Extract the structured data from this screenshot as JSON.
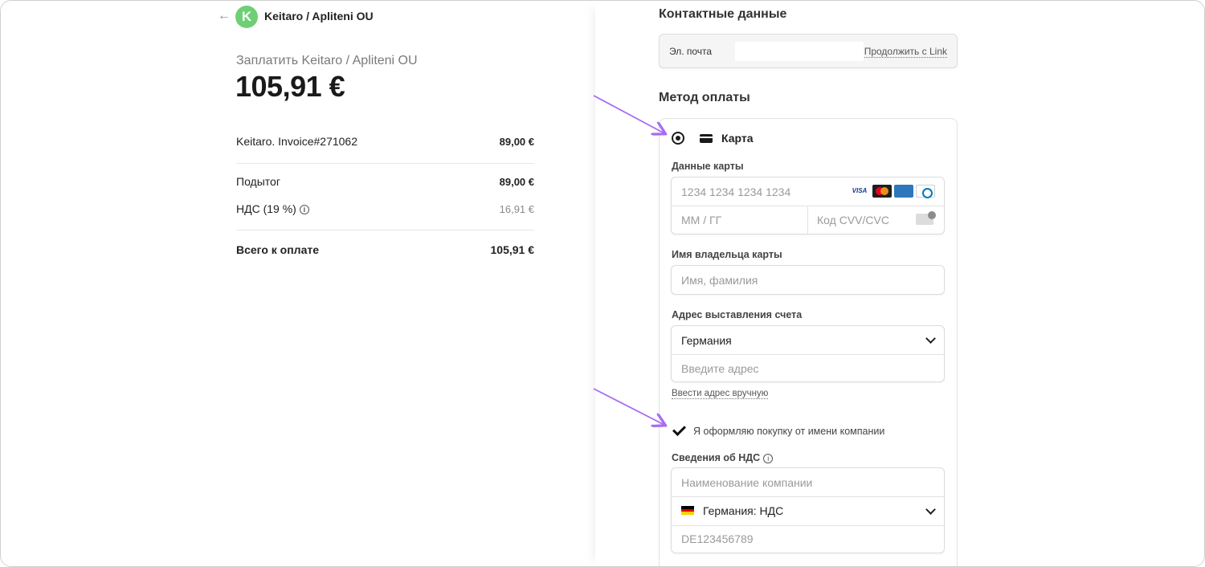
{
  "summary": {
    "merchant": "Keitaro / Apliteni OU",
    "logo_letter": "K",
    "logo_color": "#6fcf74",
    "pay_label": "Заплатить Keitaro / Apliteni OU",
    "pay_amount": "105,91 €",
    "line_item": {
      "label": "Keitaro. Invoice#271062",
      "value": "89,00 €"
    },
    "subtotal": {
      "label": "Подытог",
      "value": "89,00 €"
    },
    "vat": {
      "label": "НДС (19 %)",
      "value": "16,91 €"
    },
    "total": {
      "label": "Всего к оплате",
      "value": "105,91 €"
    }
  },
  "contact": {
    "title": "Контактные данные",
    "email_label": "Эл. почта",
    "email_value": "",
    "link_button": "Продолжить с Link"
  },
  "payment": {
    "title": "Метод оплаты",
    "method_label": "Карта",
    "card_details_label": "Данные карты",
    "card_number_placeholder": "1234 1234 1234 1234",
    "card_brands": [
      "VISA",
      "Mastercard",
      "AMEX",
      "Diners"
    ],
    "expiry_placeholder": "ММ / ГГ",
    "cvc_placeholder": "Код CVV/CVC",
    "cardholder_label": "Имя владельца карты",
    "cardholder_placeholder": "Имя, фамилия",
    "billing_label": "Адрес выставления счета",
    "country_value": "Германия",
    "address_placeholder": "Введите адрес",
    "manual_link": "Ввести адрес вручную",
    "business_checkbox_label": "Я оформляю покупку от имени компании",
    "business_checked": true,
    "vat_section_label": "Сведения об НДС",
    "company_placeholder": "Наименование компании",
    "vat_country_value": "Германия: НДС",
    "vat_number_placeholder": "DE123456789"
  },
  "annotations": {
    "arrow_color": "#a66cf0"
  }
}
